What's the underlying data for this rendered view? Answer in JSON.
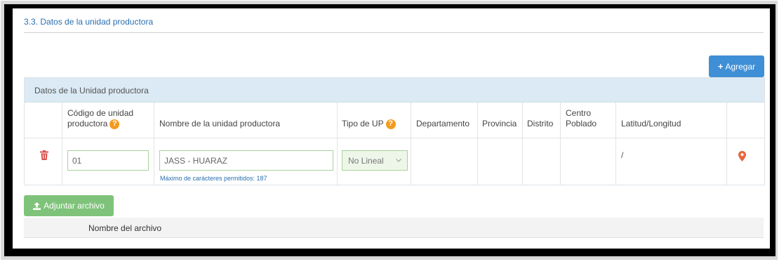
{
  "section": {
    "title": "3.3. Datos de la unidad productora"
  },
  "toolbar": {
    "add_label": "Agregar"
  },
  "grid": {
    "title": "Datos de la Unidad productora",
    "columns": {
      "codigo": [
        "Código de unidad",
        "productora"
      ],
      "nombre": "Nombre de la unidad productora",
      "tipo": "Tipo de UP",
      "departamento": "Departamento",
      "provincia": "Provincia",
      "distrito": "Distrito",
      "centro": [
        "Centro",
        "Poblado"
      ],
      "latlon": "Latitud/Longitud"
    },
    "row": {
      "codigo_value": "01",
      "nombre_value": "JASS - HUARAZ",
      "nombre_hint": "Máximo de carácteres permitidos: 187",
      "tipo_value": "No Lineal",
      "latlon_value": "/"
    }
  },
  "attachments": {
    "button_label": "Adjuntar archivo",
    "column_header": "Nombre del archivo"
  },
  "colors": {
    "primary": "#3f8fd6",
    "success": "#7fc37a",
    "danger": "#d9534f",
    "warning": "#f39b1e",
    "link": "#2a6fb0",
    "grid_header_bg": "#dbeaf5"
  },
  "icons": {
    "help": "question-circle-icon",
    "delete": "trash-icon",
    "map": "map-marker-icon",
    "upload": "upload-icon",
    "add": "plus-icon"
  }
}
